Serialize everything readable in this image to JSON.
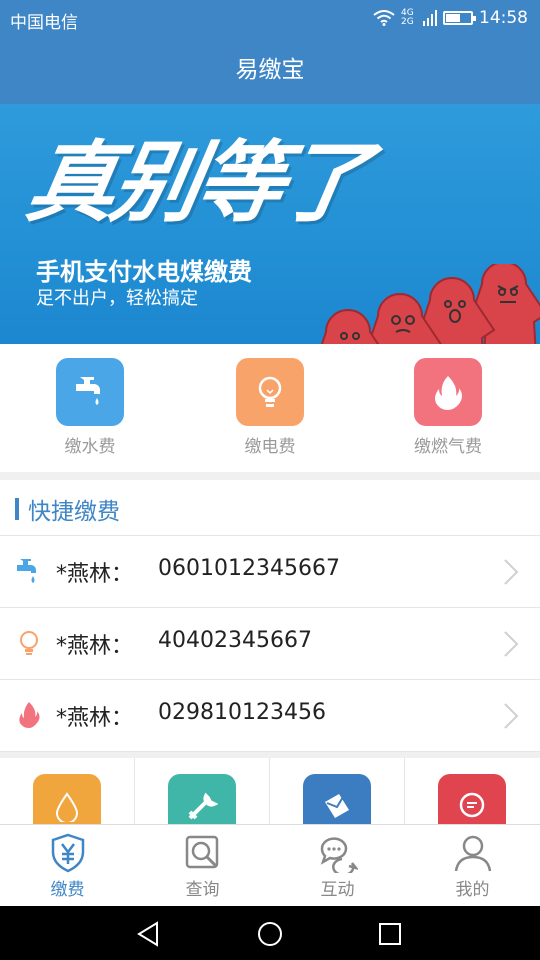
{
  "status_bar": {
    "carrier": "中国电信",
    "network": "4G\n2G",
    "time": "14:58",
    "battery_level": 0.55
  },
  "title_bar": {
    "title": "易缴宝"
  },
  "banner": {
    "slogan": "真别等了",
    "line1": "手机支付水电煤缴费",
    "line2": "足不出户，轻松搞定",
    "slide_count": 6,
    "active_slide": 0
  },
  "services": [
    {
      "label": "缴水费",
      "icon": "faucet-icon",
      "color": "#4aa6e6"
    },
    {
      "label": "缴电费",
      "icon": "lightbulb-icon",
      "color": "#f7a36a"
    },
    {
      "label": "缴燃气费",
      "icon": "flame-icon",
      "color": "#f2727d"
    }
  ],
  "quick_pay": {
    "title": "快捷缴费",
    "rows": [
      {
        "name": "*燕林：",
        "number": "0601012345667",
        "icon": "faucet-icon",
        "color": "#4aa6e6"
      },
      {
        "name": "*燕林：",
        "number": "40402345667",
        "icon": "lightbulb-icon",
        "color": "#f7a36a"
      },
      {
        "name": "*燕林：",
        "number": "029810123456",
        "icon": "flame-icon",
        "color": "#f2727d"
      }
    ]
  },
  "tiles": [
    {
      "icon": "water-drop-icon",
      "color": "#f0a63c"
    },
    {
      "icon": "tools-icon",
      "color": "#3fb6a8"
    },
    {
      "icon": "envelope-icon",
      "color": "#3c7cc0"
    },
    {
      "icon": "chat-bubble-icon",
      "color": "#e0454f"
    }
  ],
  "tab_bar": {
    "active": 0,
    "tabs": [
      {
        "label": "缴费",
        "icon": "yuan-shield-icon"
      },
      {
        "label": "查询",
        "icon": "search-doc-icon"
      },
      {
        "label": "互动",
        "icon": "chat-icon"
      },
      {
        "label": "我的",
        "icon": "user-icon"
      }
    ]
  },
  "colors": {
    "primary": "#3f86c6",
    "banner": "#1f8ad1"
  }
}
